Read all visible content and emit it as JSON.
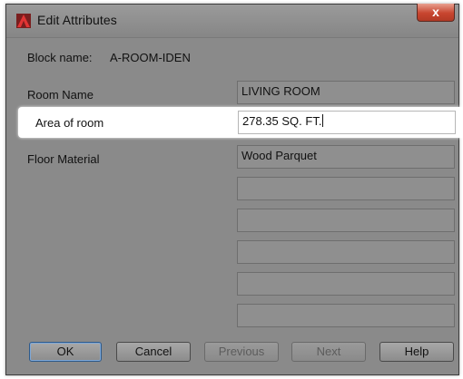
{
  "window": {
    "title": "Edit Attributes",
    "close_glyph": "x",
    "app_icon": "autocad-a-icon"
  },
  "block": {
    "label": "Block name:",
    "value": "A-ROOM-IDEN"
  },
  "attributes": [
    {
      "label": "Room Name",
      "value": "LIVING ROOM"
    },
    {
      "label": "Area of room",
      "value": "278.35 SQ. FT."
    },
    {
      "label": "Floor Material",
      "value": "Wood Parquet"
    }
  ],
  "buttons": {
    "ok": "OK",
    "cancel": "Cancel",
    "previous": "Previous",
    "next": "Next",
    "help": "Help"
  },
  "colors": {
    "dialog_bg": "#8a8a8a",
    "close_button": "#c8452f",
    "highlight": "#ffffff",
    "app_icon_red": "#c0282a"
  }
}
